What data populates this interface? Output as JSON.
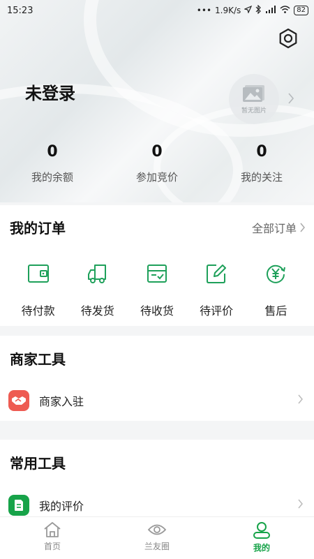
{
  "status_bar": {
    "time": "15:23",
    "network_speed": "1.9K/s",
    "battery": "82"
  },
  "header": {
    "login_status": "未登录",
    "avatar_placeholder": "暂无图片",
    "stats": [
      {
        "value": "0",
        "label": "我的余额"
      },
      {
        "value": "0",
        "label": "参加竞价"
      },
      {
        "value": "0",
        "label": "我的关注"
      }
    ]
  },
  "orders": {
    "title": "我的订单",
    "all_link": "全部订单",
    "items": [
      {
        "label": "待付款",
        "icon": "wallet-icon"
      },
      {
        "label": "待发货",
        "icon": "truck-icon"
      },
      {
        "label": "待收货",
        "icon": "box-check-icon"
      },
      {
        "label": "待评价",
        "icon": "edit-icon"
      },
      {
        "label": "售后",
        "icon": "yen-refresh-icon"
      }
    ]
  },
  "merchant_tools": {
    "title": "商家工具",
    "items": [
      {
        "label": "商家入驻",
        "icon": "handshake-icon",
        "color": "#ee5b52"
      }
    ]
  },
  "common_tools": {
    "title": "常用工具",
    "items": [
      {
        "label": "我的评价",
        "icon": "note-icon",
        "color": "#17a349"
      }
    ]
  },
  "tabbar": {
    "tabs": [
      {
        "label": "首页",
        "icon": "home-icon",
        "active": false
      },
      {
        "label": "兰友圈",
        "icon": "eye-icon",
        "active": false
      },
      {
        "label": "我的",
        "icon": "user-icon",
        "active": true
      }
    ]
  },
  "colors": {
    "accent": "#17a349",
    "icon_green": "#1ea05a",
    "merchant_red": "#ee5b52"
  }
}
